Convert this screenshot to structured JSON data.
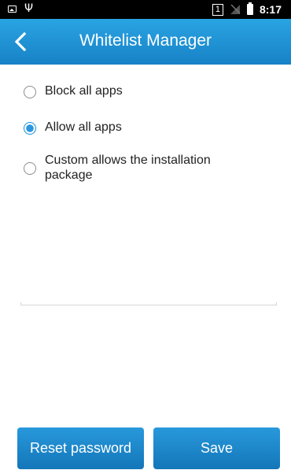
{
  "status_bar": {
    "icons": [
      "image-icon",
      "usb-icon",
      "sim-badge-icon",
      "signal-off-icon",
      "battery-icon"
    ],
    "sim_number": "1",
    "time": "8:17"
  },
  "header": {
    "title": "Whitelist Manager",
    "back_icon": "chevron-left-icon",
    "background_color": "#1e8fd5"
  },
  "options": [
    {
      "label": "Block all apps",
      "selected": false
    },
    {
      "label": "Allow all apps",
      "selected": true
    },
    {
      "label": "Custom allows the installation package",
      "selected": false
    }
  ],
  "buttons": {
    "reset_label": "Reset password",
    "save_label": "Save"
  },
  "colors": {
    "accent": "#1a8fd8",
    "button": "#1b86c8"
  }
}
